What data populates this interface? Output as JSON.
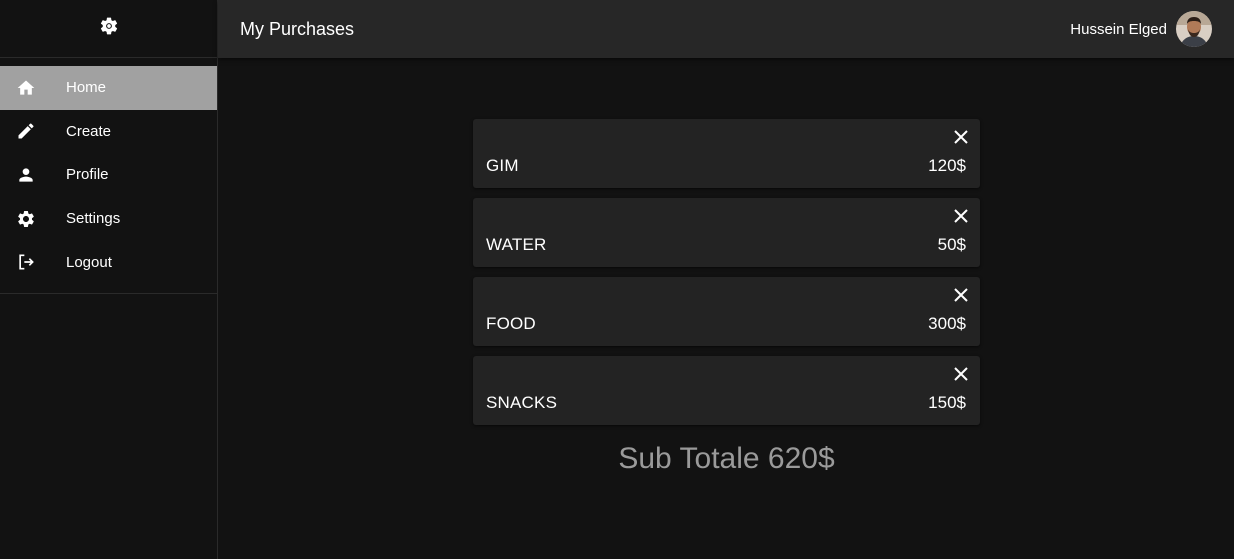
{
  "sidebar": {
    "logo_icon": "gear-logo-icon",
    "items": [
      {
        "label": "Home",
        "icon": "home-icon",
        "active": true
      },
      {
        "label": "Create",
        "icon": "pencil-icon",
        "active": false
      },
      {
        "label": "Profile",
        "icon": "person-icon",
        "active": false
      },
      {
        "label": "Settings",
        "icon": "gear-icon",
        "active": false
      },
      {
        "label": "Logout",
        "icon": "logout-icon",
        "active": false
      }
    ]
  },
  "header": {
    "title": "My Purchases",
    "user_name": "Hussein Elged"
  },
  "purchases": [
    {
      "name": "GIM",
      "price": "120$"
    },
    {
      "name": "WATER",
      "price": "50$"
    },
    {
      "name": "FOOD",
      "price": "300$"
    },
    {
      "name": "SNACKS",
      "price": "150$"
    }
  ],
  "subtotal": "Sub Totale 620$",
  "colors": {
    "background": "#121212",
    "appbar": "#272727",
    "card": "#232323",
    "active_nav": "#a1a1a1",
    "subtotal_text": "#9a9a9a"
  }
}
